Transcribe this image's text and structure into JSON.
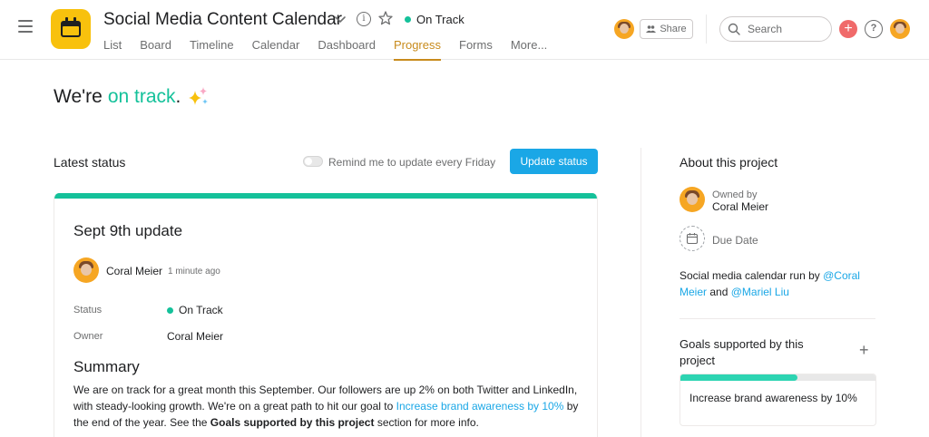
{
  "header": {
    "project_title": "Social Media Content Calendar",
    "status": "On Track",
    "tabs": [
      {
        "label": "List"
      },
      {
        "label": "Board"
      },
      {
        "label": "Timeline"
      },
      {
        "label": "Calendar"
      },
      {
        "label": "Dashboard"
      },
      {
        "label": "Progress"
      },
      {
        "label": "Forms"
      },
      {
        "label": "More..."
      }
    ],
    "active_tab": "Progress",
    "share_label": "Share",
    "search_placeholder": "Search"
  },
  "hero": {
    "prefix": "We're",
    "accent": "on track",
    "suffix": "."
  },
  "latest_status": {
    "title": "Latest status",
    "remind_label": "Remind me to update every Friday",
    "remind_enabled": false,
    "update_button": "Update status"
  },
  "update_card": {
    "title": "Sept 9th update",
    "author": "Coral Meier",
    "time": "1 minute ago",
    "fields": {
      "status_label": "Status",
      "status_value": "On Track",
      "owner_label": "Owner",
      "owner_value": "Coral Meier"
    },
    "summary_title": "Summary",
    "summary": {
      "part1": "We are on track for a great month this September. Our followers are up 2% on both Twitter and LinkedIn, with steady-looking growth. We're on a great path to hit our goal to ",
      "link": "Increase brand awareness by 10%",
      "part2": " by the end of the year. See the ",
      "bold": "Goals supported by this project",
      "part3": " section for more info."
    }
  },
  "about": {
    "title": "About this project",
    "owned_by_label": "Owned by",
    "owner_name": "Coral Meier",
    "due_date_label": "Due Date",
    "description": {
      "part1": "Social media calendar run by ",
      "mention1": "@Coral Meier",
      "part2": " and ",
      "mention2": "@Mariel Liu"
    }
  },
  "goals": {
    "title": "Goals supported by this project",
    "items": [
      {
        "label": "Increase brand awareness by 10%",
        "progress": 0.6
      }
    ]
  },
  "colors": {
    "accent_green": "#14c19a",
    "progress_tab": "#c88b1c",
    "primary_button": "#1aa7e6",
    "app_icon": "#f8c10d",
    "add_button": "#f06a6a"
  },
  "icons": {
    "menu": "hamburger-icon",
    "app": "calendar-icon",
    "info": "info-icon",
    "favorite": "star-icon",
    "search": "search-icon",
    "add": "plus-icon",
    "help": "help-icon",
    "hero": "sparkles-icon",
    "due": "calendar-icon"
  }
}
